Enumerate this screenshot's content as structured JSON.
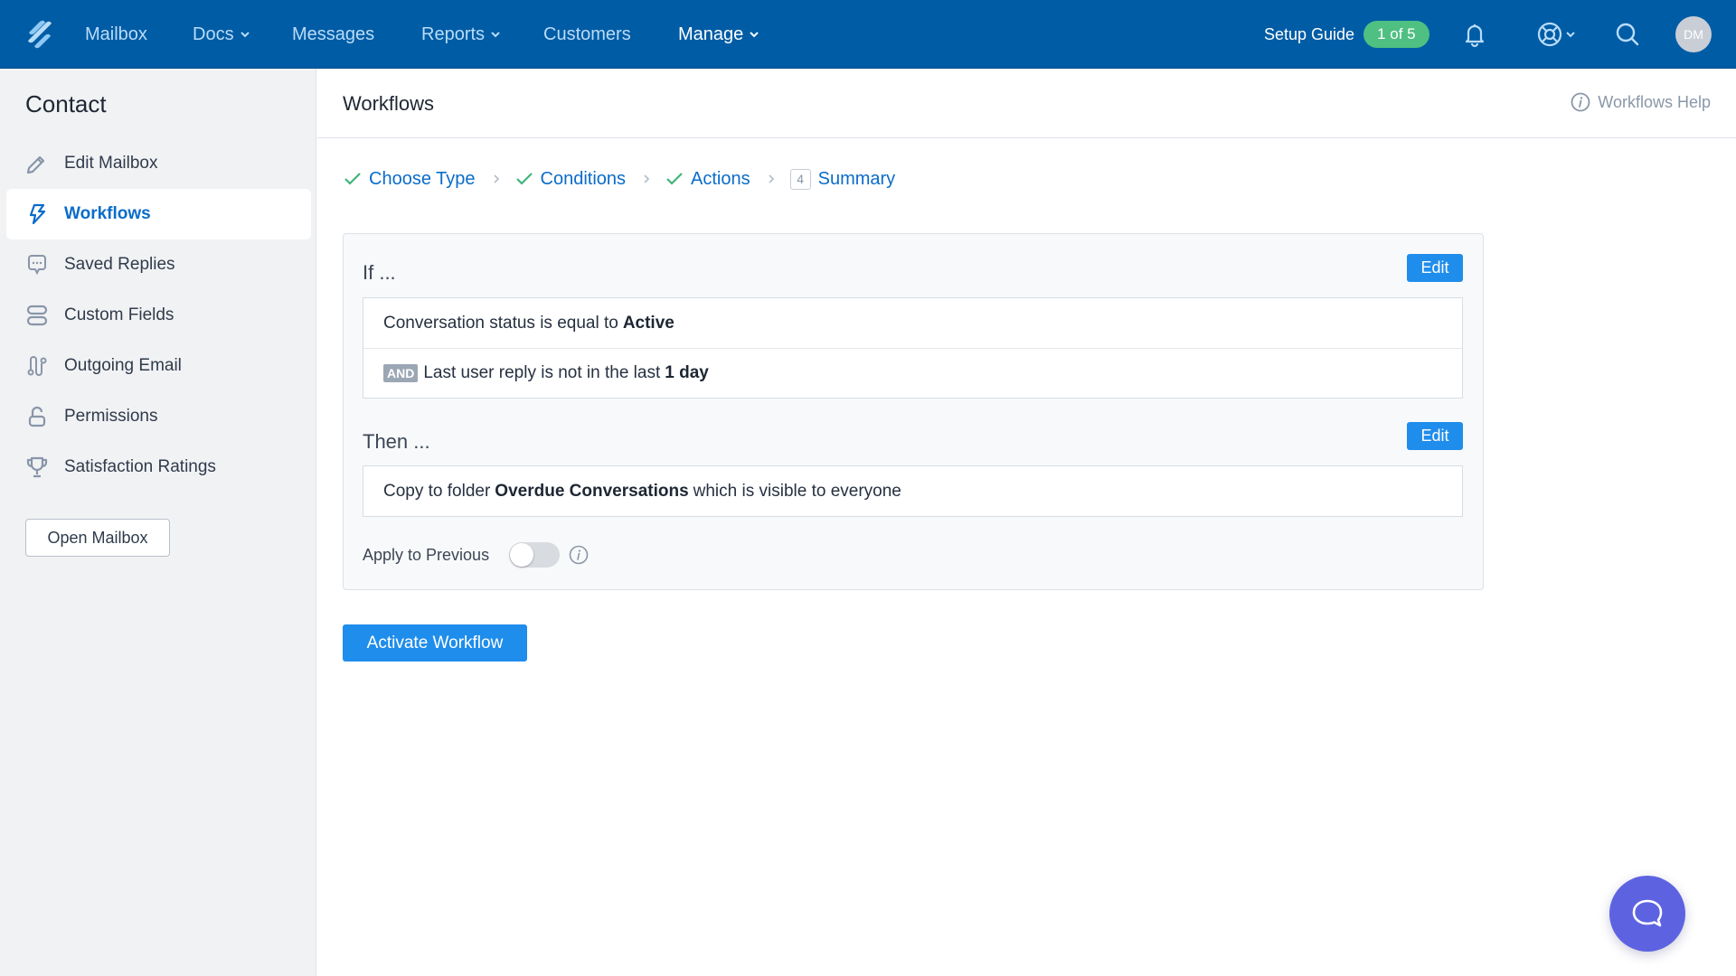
{
  "topnav": {
    "logo": "helpscout-logo-icon",
    "items": [
      {
        "label": "Mailbox",
        "dropdown": false,
        "active": false
      },
      {
        "label": "Docs",
        "dropdown": true,
        "active": false
      },
      {
        "label": "Messages",
        "dropdown": false,
        "active": false
      },
      {
        "label": "Reports",
        "dropdown": true,
        "active": false
      },
      {
        "label": "Customers",
        "dropdown": false,
        "active": false
      },
      {
        "label": "Manage",
        "dropdown": true,
        "active": true
      }
    ],
    "setup_guide": {
      "label": "Setup Guide",
      "badge": "1 of 5"
    },
    "icons": [
      "bell-icon",
      "help-lifebuoy-icon",
      "search-icon"
    ],
    "avatar_initials": "DM",
    "colors": {
      "bar": "#005ca5",
      "badge": "#4fbf82"
    }
  },
  "sidebar": {
    "title": "Contact",
    "items": [
      {
        "label": "Edit Mailbox",
        "icon": "pencil-icon",
        "active": false
      },
      {
        "label": "Workflows",
        "icon": "lightning-icon",
        "active": true
      },
      {
        "label": "Saved Replies",
        "icon": "chat-bubble-icon",
        "active": false
      },
      {
        "label": "Custom Fields",
        "icon": "fields-icon",
        "active": false
      },
      {
        "label": "Outgoing Email",
        "icon": "route-icon",
        "active": false
      },
      {
        "label": "Permissions",
        "icon": "unlock-icon",
        "active": false
      },
      {
        "label": "Satisfaction Ratings",
        "icon": "trophy-icon",
        "active": false
      }
    ],
    "open_mailbox_label": "Open Mailbox"
  },
  "main": {
    "title": "Workflows",
    "help_link": "Workflows Help",
    "steps": [
      {
        "label": "Choose Type",
        "status": "done"
      },
      {
        "label": "Conditions",
        "status": "done"
      },
      {
        "label": "Actions",
        "status": "done"
      },
      {
        "label": "Summary",
        "status": "current",
        "number": "4"
      }
    ],
    "if_section": {
      "label": "If ...",
      "edit_label": "Edit",
      "conditions": [
        {
          "prefix": "",
          "text": "Conversation status is equal to",
          "value": "Active"
        },
        {
          "prefix": "AND",
          "text": "Last user reply is not in the last",
          "value": "1 day"
        }
      ]
    },
    "then_section": {
      "label": "Then ...",
      "edit_label": "Edit",
      "actions": [
        {
          "text": "Copy to folder",
          "value": "Overdue Conversations",
          "suffix": "which is visible to everyone"
        }
      ]
    },
    "apply_to_previous": {
      "label": "Apply to Previous",
      "enabled": false
    },
    "activate_label": "Activate Workflow",
    "accent": "#1f8deb"
  },
  "chat_widget": {
    "icon": "chat-icon",
    "color": "#5d63e0"
  }
}
